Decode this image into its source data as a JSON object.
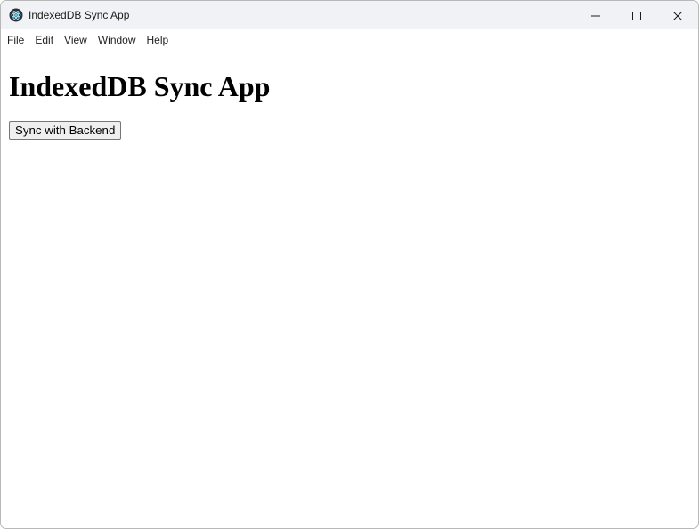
{
  "window": {
    "title": "IndexedDB Sync App",
    "controls": [
      "minimize-icon",
      "maximize-icon",
      "close-icon"
    ],
    "app_icon": "electron-icon"
  },
  "menu": {
    "items": [
      {
        "label": "File"
      },
      {
        "label": "Edit"
      },
      {
        "label": "View"
      },
      {
        "label": "Window"
      },
      {
        "label": "Help"
      }
    ]
  },
  "main": {
    "heading": "IndexedDB Sync App",
    "sync_button_label": "Sync with Backend"
  },
  "colors": {
    "titlebar_bg": "#f0f2f5",
    "button_bg": "#efefef",
    "button_border": "#767676"
  }
}
